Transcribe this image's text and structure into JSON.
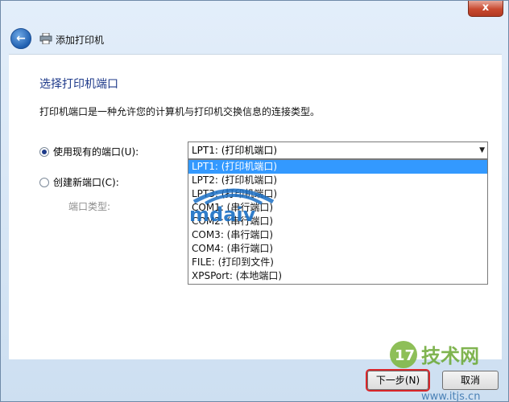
{
  "window": {
    "close_glyph": "x",
    "title": "添加打印机",
    "back_glyph": "←"
  },
  "page": {
    "heading": "选择打印机端口",
    "description": "打印机端口是一种允许您的计算机与打印机交换信息的连接类型。"
  },
  "options": {
    "use_existing_label": "使用现有的端口(U):",
    "create_new_label": "创建新端口(C):",
    "port_type_label": "端口类型:",
    "use_existing_selected": true
  },
  "select": {
    "value": "LPT1: (打印机端口)",
    "arrow": "▼",
    "items": [
      "LPT1: (打印机端口)",
      "LPT2: (打印机端口)",
      "LPT3: (打印机端口)",
      "COM1: (串行端口)",
      "COM2: (串行端口)",
      "COM3: (串行端口)",
      "COM4: (串行端口)",
      "FILE: (打印到文件)",
      "XPSPort: (本地端口)"
    ],
    "selected_index": 0
  },
  "footer": {
    "next_label": "下一步(N)",
    "cancel_label": "取消"
  },
  "watermarks": {
    "logo_text": "mdaiv",
    "site_text": "技术网",
    "site_badge": "17",
    "site_url": "www.itjs.cn"
  },
  "colors": {
    "heading": "#1e3a8a",
    "selection": "#3399ff",
    "highlight_border": "#d9262a"
  }
}
